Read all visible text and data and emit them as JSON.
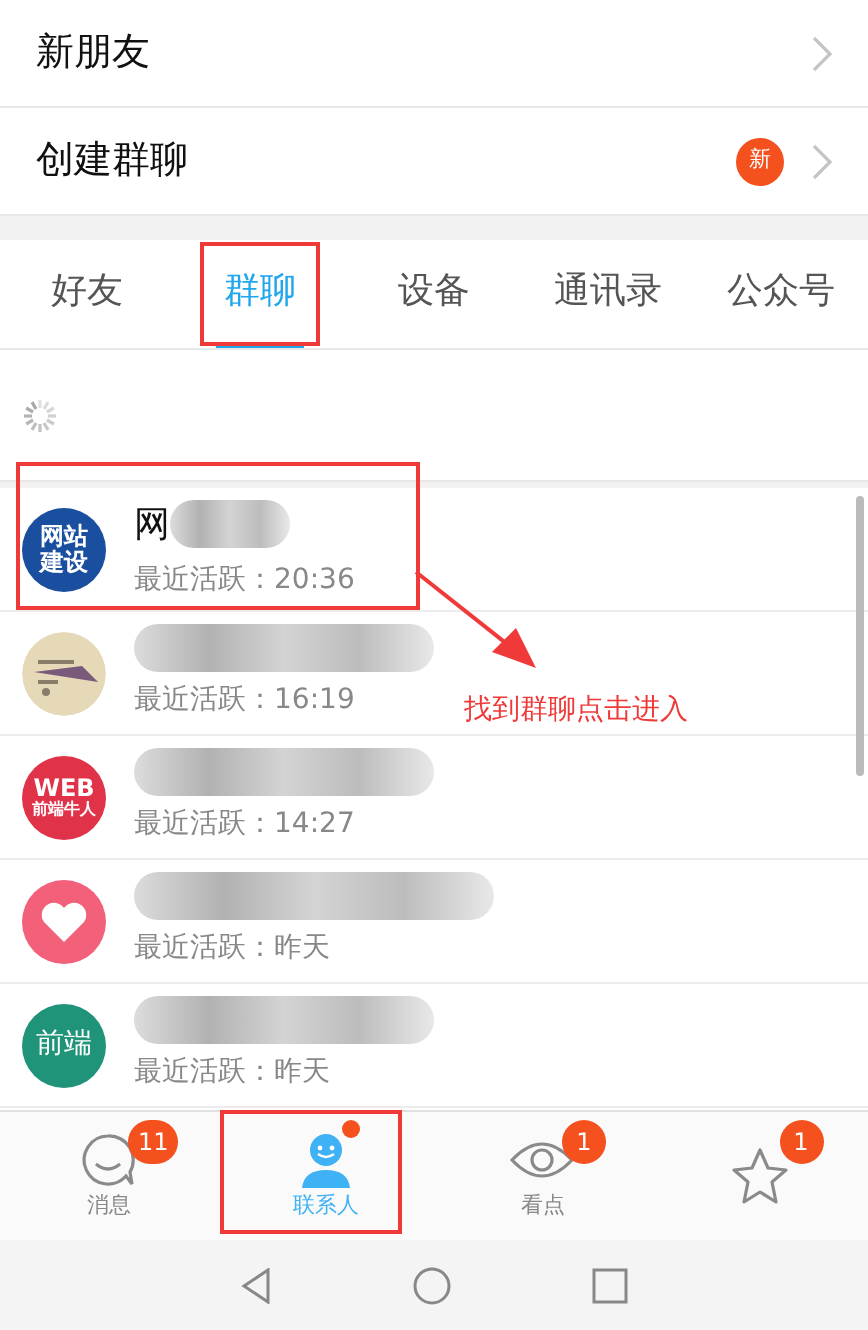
{
  "menu": [
    {
      "label": "新朋友"
    },
    {
      "label": "创建群聊",
      "badge": "新"
    }
  ],
  "tabs": [
    {
      "label": "好友",
      "selected": false
    },
    {
      "label": "群聊",
      "selected": true
    },
    {
      "label": "设备",
      "selected": false
    },
    {
      "label": "通讯录",
      "selected": false
    },
    {
      "label": "公众号",
      "selected": false
    }
  ],
  "groups": [
    {
      "name": "网",
      "subtitle": "最近活跃：20:36",
      "avatar": {
        "kind": "text",
        "lines": [
          "网站",
          "建设"
        ],
        "color": "#1a4fa0"
      }
    },
    {
      "subtitle": "最近活跃：16:19"
    },
    {
      "subtitle": "最近活跃：14:27",
      "avatar": {
        "kind": "text",
        "lines": [
          "WEB",
          "前端牛人"
        ],
        "color": "#e0334a"
      }
    },
    {
      "subtitle": "最近活跃：昨天",
      "avatar": {
        "kind": "heart",
        "color": "#f2607a"
      }
    },
    {
      "subtitle": "最近活跃：昨天",
      "avatar": {
        "kind": "text",
        "lines": [
          "前端"
        ],
        "color": "#1f9478"
      }
    }
  ],
  "bottom_nav": [
    {
      "kind": "chat",
      "label": "消息",
      "badge": "11",
      "dot": false,
      "selected": false
    },
    {
      "kind": "contacts",
      "label": "联系人",
      "dot": true,
      "selected": true
    },
    {
      "kind": "eye",
      "label": "看点",
      "badge": "1",
      "dot": false,
      "selected": false
    },
    {
      "kind": "star",
      "badge": "1",
      "dot": false,
      "selected": false
    }
  ],
  "annotation": {
    "text": "找到群聊点击进入"
  }
}
